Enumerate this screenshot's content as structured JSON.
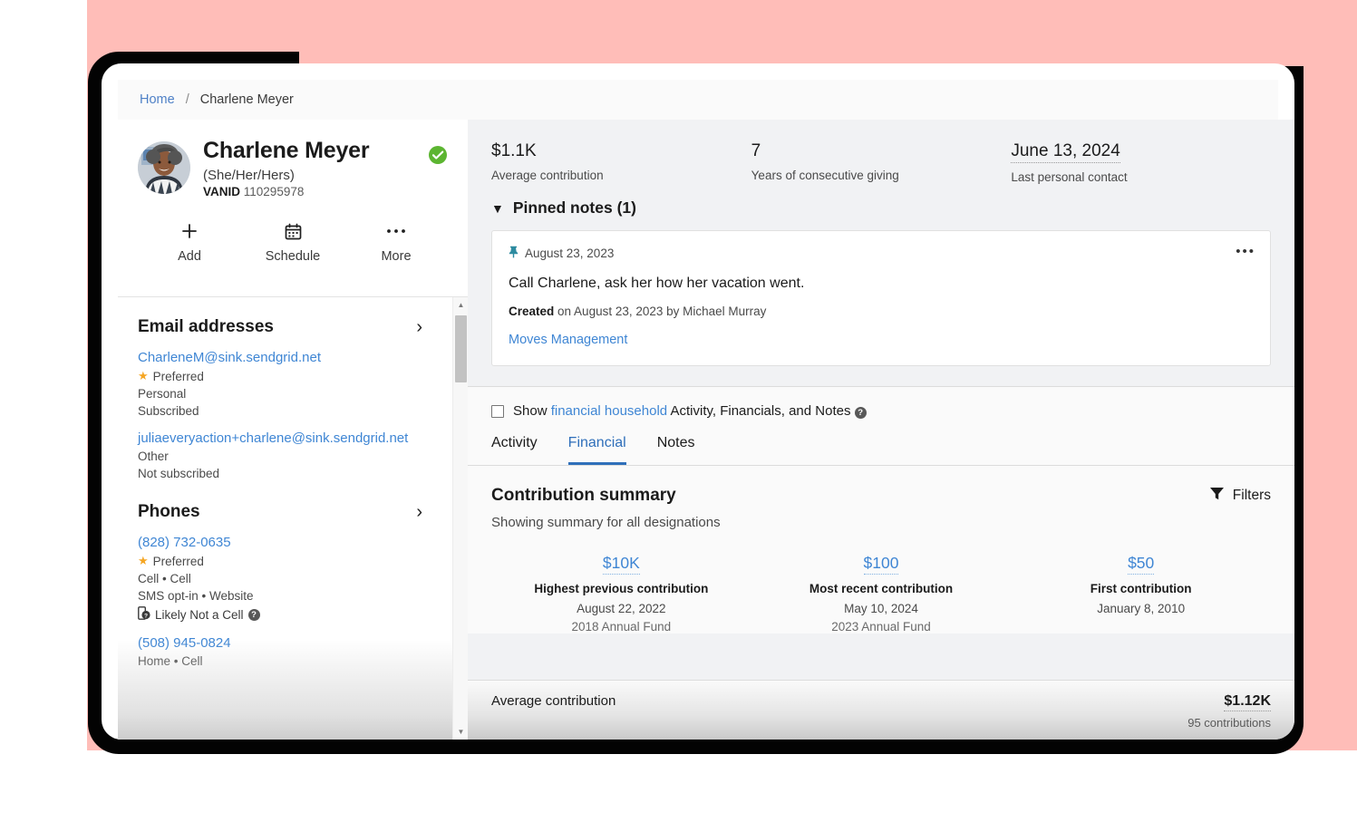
{
  "breadcrumb": {
    "home": "Home",
    "separator": "/",
    "current": "Charlene Meyer"
  },
  "profile": {
    "name": "Charlene Meyer",
    "pronouns": "(She/Her/Hers)",
    "vanid_label": "VANID",
    "vanid_value": "110295978",
    "verified_icon": "verified-check-icon",
    "actions": [
      {
        "icon": "plus-icon",
        "label": "Add"
      },
      {
        "icon": "calendar-icon",
        "label": "Schedule"
      },
      {
        "icon": "ellipsis-icon",
        "label": "More"
      }
    ]
  },
  "sidebar": {
    "email_section": {
      "title": "Email addresses",
      "entries": [
        {
          "value": "CharleneM@sink.sendgrid.net",
          "preferred": "Preferred",
          "type": "Personal",
          "status": "Subscribed"
        },
        {
          "value": "juliaeveryaction+charlene@sink.sendgrid.net",
          "preferred": "",
          "type": "Other",
          "status": "Not subscribed"
        }
      ]
    },
    "phone_section": {
      "title": "Phones",
      "entries": [
        {
          "value": "(828) 732-0635",
          "preferred": "Preferred",
          "type": "Cell • Cell",
          "status": "SMS opt-in • Website",
          "flag": "Likely Not a Cell"
        },
        {
          "value": "(508) 945-0824",
          "type": "Home • Cell"
        }
      ]
    }
  },
  "stats": [
    {
      "value": "$1.1K",
      "label": "Average contribution",
      "dotted": false
    },
    {
      "value": "7",
      "label": "Years of consecutive giving",
      "dotted": false
    },
    {
      "value": "June 13, 2024",
      "label": "Last personal contact",
      "dotted": true
    }
  ],
  "pinned": {
    "heading": "Pinned notes (1)",
    "note": {
      "date": "August 23, 2023",
      "body": "Call Charlene, ask her how her vacation went.",
      "created_label": "Created",
      "created_rest": " on August 23, 2023 by Michael Murray",
      "tag": "Moves Management",
      "menu_icon": "ellipsis-icon"
    }
  },
  "household": {
    "prefix": "Show ",
    "link": "financial household",
    "suffix": " Activity, Financials, and Notes",
    "help_icon": "help-circle-icon"
  },
  "tabs": [
    {
      "label": "Activity",
      "active": false
    },
    {
      "label": "Financial",
      "active": true
    },
    {
      "label": "Notes",
      "active": false
    }
  ],
  "contribution_summary": {
    "title": "Contribution summary",
    "subtitle": "Showing summary for all designations",
    "filters_label": "Filters",
    "filters_icon": "funnel-icon",
    "kpis": [
      {
        "value": "$10K",
        "label": "Highest previous contribution",
        "date": "August 22, 2022",
        "fund": "2018 Annual Fund"
      },
      {
        "value": "$100",
        "label": "Most recent contribution",
        "date": "May 10, 2024",
        "fund": "2023 Annual Fund"
      },
      {
        "value": "$50",
        "label": "First contribution",
        "date": "January 8, 2010",
        "fund": ""
      }
    ],
    "average_row": {
      "label": "Average contribution",
      "value": "$1.12K",
      "count": "95 contributions"
    }
  },
  "colors": {
    "backdrop_pink": "#ffbdb8",
    "device_frame": "#030303",
    "link_blue": "#3f86d4",
    "tab_active": "#2f6fba",
    "verified_green": "#5cb531",
    "star_gold": "#f5a623",
    "pin_teal": "#2d8ba0"
  }
}
